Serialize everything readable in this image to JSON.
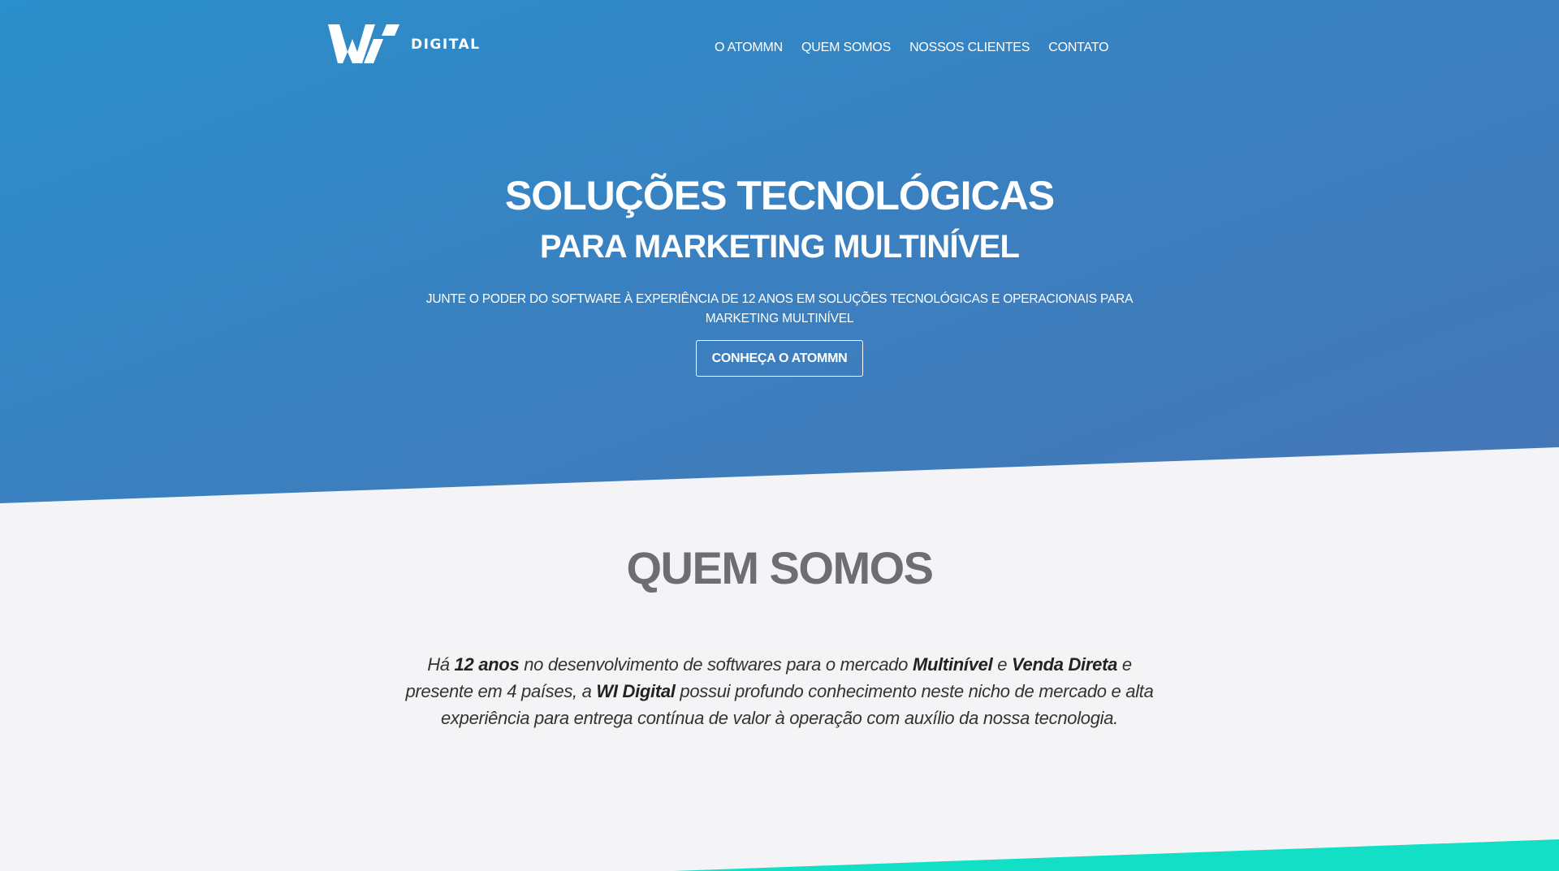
{
  "header": {
    "logo_text": "DIGITAL",
    "nav": [
      {
        "label": "O ATOMMN"
      },
      {
        "label": "QUEM SOMOS"
      },
      {
        "label": "NOSSOS CLIENTES"
      },
      {
        "label": "CONTATO"
      }
    ]
  },
  "hero": {
    "title": "SOLUÇÕES TECNOLÓGICAS",
    "subtitle": "PARA MARKETING MULTINÍVEL",
    "description": "JUNTE O PODER DO SOFTWARE À EXPERIÊNCIA DE 12 ANOS EM SOLUÇÕES TECNOLÓGICAS E OPERACIONAIS PARA MARKETING MULTINÍVEL",
    "cta_label": "CONHEÇA O ATOMMN"
  },
  "about": {
    "title": "QUEM SOMOS",
    "text": {
      "p1": "Há ",
      "b1": "12 anos",
      "p2": " no desenvolvimento de softwares para o mercado ",
      "b2": "Multinível",
      "p3": " e ",
      "b3": "Venda Direta",
      "p4": " e presente em 4 países, a ",
      "b4": "WI Digital",
      "p5": " possui profundo conhecimento neste nicho de mercado e alta experiência para entrega contínua de valor à operação com auxílio da nossa tecnologia."
    }
  },
  "colors": {
    "hero_start": "#2a8fca",
    "hero_end": "#4676b6",
    "page_bg": "#f4f4f6",
    "section_title": "#6c6e72",
    "accent_teal": "#12dfc6"
  },
  "icons": {
    "logo": "wi-logo-icon"
  }
}
